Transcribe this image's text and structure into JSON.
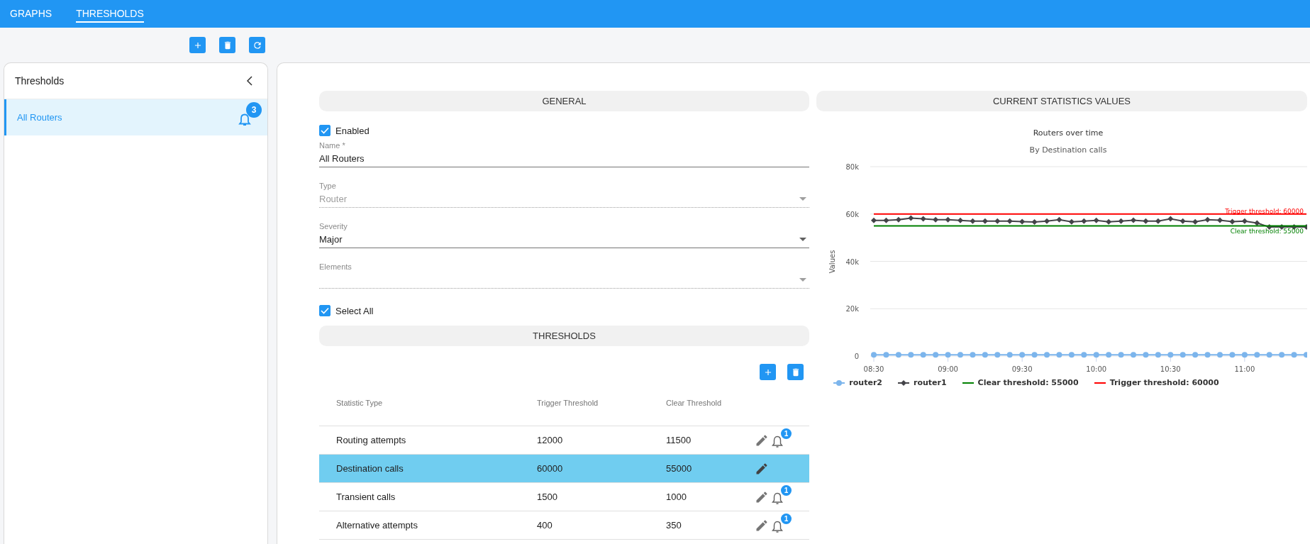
{
  "tabs": [
    {
      "label": "GRAPHS",
      "selected": false
    },
    {
      "label": "THRESHOLDS",
      "selected": true
    }
  ],
  "toolbar": {
    "buttons": [
      {
        "kind": "add"
      },
      {
        "kind": "delete"
      },
      {
        "kind": "refresh"
      }
    ]
  },
  "sidebar": {
    "title": "Thresholds",
    "items": [
      {
        "label": "All Routers",
        "selected": true,
        "alarms": "3"
      }
    ]
  },
  "general": {
    "title": "GENERAL",
    "enabled": {
      "label": "Enabled",
      "checked": true
    },
    "fields": [
      {
        "kind": "text",
        "label": "Name *",
        "value": "All Routers",
        "disabled": false
      },
      {
        "kind": "select",
        "label": "Type",
        "value": "Router",
        "disabled": true
      },
      {
        "kind": "select",
        "label": "Severity",
        "value": "Major",
        "disabled": false
      },
      {
        "kind": "select",
        "label": "Elements",
        "disabled": true
      }
    ],
    "select_all": {
      "label": "Select All",
      "checked": true
    }
  },
  "thresholds": {
    "title": "THRESHOLDS",
    "buttons": [
      {
        "kind": "add"
      },
      {
        "kind": "delete"
      }
    ],
    "columns": [
      "Statistic Type",
      "Trigger Threshold",
      "Clear Threshold"
    ],
    "rows": [
      {
        "statistic": "Routing attempts",
        "trigger": "12000",
        "clear": "11500",
        "selected": false,
        "alarms": "1"
      },
      {
        "statistic": "Destination calls",
        "trigger": "60000",
        "clear": "55000",
        "selected": true
      },
      {
        "statistic": "Transient calls",
        "trigger": "1500",
        "clear": "1000",
        "selected": false,
        "alarms": "1"
      },
      {
        "statistic": "Alternative attempts",
        "trigger": "400",
        "clear": "350",
        "selected": false,
        "alarms": "1"
      }
    ]
  },
  "statistics": {
    "title": "CURRENT STATISTICS VALUES",
    "chart_data": {
      "type": "line",
      "title": "Routers over time",
      "subtitle": "By Destination calls",
      "ylabel": "Values",
      "categories": [
        "08:30",
        null,
        null,
        null,
        null,
        null,
        "09:00",
        null,
        null,
        null,
        null,
        null,
        "09:30",
        null,
        null,
        null,
        null,
        null,
        "10:00",
        null,
        null,
        null,
        null,
        null,
        "10:30",
        null,
        null,
        null,
        null,
        null,
        "11:00",
        null,
        null,
        null,
        null,
        null
      ],
      "ylim": [
        0,
        80000
      ],
      "grid": true,
      "legend": true,
      "yticks": [
        {
          "value": 0,
          "label": "0"
        },
        {
          "value": 20000,
          "label": "20k"
        },
        {
          "value": 40000,
          "label": "40k"
        },
        {
          "value": 60000,
          "label": "60k"
        },
        {
          "value": 80000,
          "label": "80k"
        }
      ],
      "series": [
        {
          "name": "router2",
          "color": "#7cb5ec",
          "marker": "circle",
          "values": [
            500,
            500,
            500,
            500,
            500,
            500,
            500,
            500,
            500,
            500,
            500,
            500,
            500,
            500,
            500,
            500,
            500,
            500,
            500,
            500,
            500,
            500,
            500,
            500,
            500,
            500,
            500,
            500,
            500,
            500,
            500,
            500,
            500,
            500,
            500,
            500
          ]
        },
        {
          "name": "router1",
          "color": "#434348",
          "marker": "diamond",
          "values": [
            57300,
            57300,
            57600,
            58300,
            58000,
            57600,
            57600,
            57300,
            57000,
            57000,
            57000,
            57000,
            56800,
            56600,
            57000,
            57600,
            56700,
            57000,
            57300,
            56700,
            57000,
            57400,
            57000,
            57000,
            58000,
            57000,
            56700,
            57600,
            57400,
            56800,
            57000,
            56200,
            54500,
            54500,
            54500,
            54500
          ]
        },
        {
          "name": "Clear threshold: 55000",
          "color": "#008000",
          "marker": "none",
          "values": [
            55000,
            55000,
            55000,
            55000,
            55000,
            55000,
            55000,
            55000,
            55000,
            55000,
            55000,
            55000,
            55000,
            55000,
            55000,
            55000,
            55000,
            55000,
            55000,
            55000,
            55000,
            55000,
            55000,
            55000,
            55000,
            55000,
            55000,
            55000,
            55000,
            55000,
            55000,
            55000,
            55000,
            55000,
            55000,
            55000
          ]
        },
        {
          "name": "Trigger threshold: 60000",
          "color": "#ff0000",
          "marker": "none",
          "values": [
            60000,
            60000,
            60000,
            60000,
            60000,
            60000,
            60000,
            60000,
            60000,
            60000,
            60000,
            60000,
            60000,
            60000,
            60000,
            60000,
            60000,
            60000,
            60000,
            60000,
            60000,
            60000,
            60000,
            60000,
            60000,
            60000,
            60000,
            60000,
            60000,
            60000,
            60000,
            60000,
            60000,
            60000,
            60000,
            60000
          ]
        }
      ],
      "annotations": [
        {
          "text": "Trigger threshold: 60000",
          "y": 61200
        },
        {
          "text": "Clear threshold: 55000",
          "y": 52800
        }
      ]
    }
  }
}
